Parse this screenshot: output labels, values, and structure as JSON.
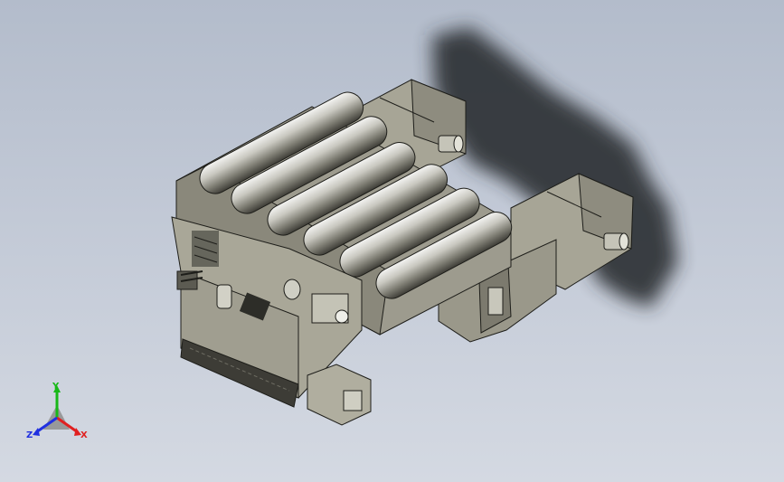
{
  "viewport": {
    "background_top": "#b3bccb",
    "background_bottom": "#d4d9e2",
    "model_color": "#a7a596",
    "shadow_color": "#2b2d33"
  },
  "triad": {
    "x_label": "X",
    "y_label": "Y",
    "z_label": "Z",
    "x_color": "#e02020",
    "y_color": "#18b818",
    "z_color": "#2030e0",
    "icon": "axis-triad-icon"
  }
}
